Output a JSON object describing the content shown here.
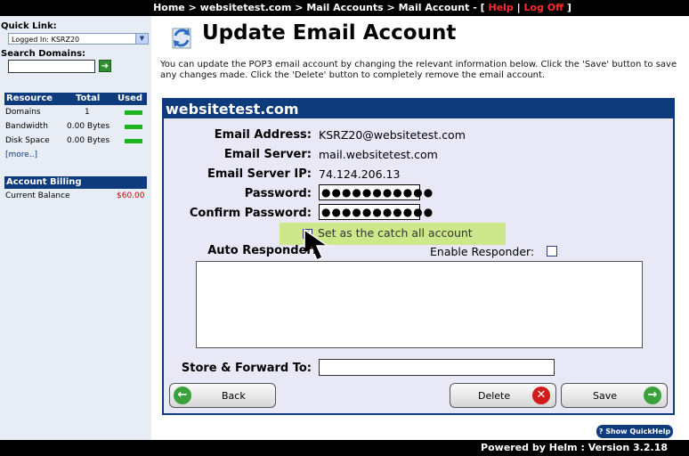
{
  "topnav": {
    "home": "Home",
    "sep": ">",
    "domain": "websitetest.com",
    "mail_accounts": "Mail Accounts",
    "mail_account": "Mail Account",
    "dash": "- [",
    "help": "Help",
    "pipe": "|",
    "logoff": "Log Off",
    "close": "]"
  },
  "sidebar": {
    "quick_link_label": "Quick Link:",
    "quick_link_value": "Logged In: KSRZ20",
    "search_label": "Search Domains:",
    "resource_table": {
      "headers": [
        "Resource",
        "Total",
        "Used"
      ],
      "rows": [
        {
          "name": "Domains",
          "total": "1",
          "used_fill": 1.0
        },
        {
          "name": "Bandwidth",
          "total": "0.00 Bytes",
          "used_fill": 1.0
        },
        {
          "name": "Disk Space",
          "total": "0.00 Bytes",
          "used_fill": 1.0
        }
      ],
      "more": "[more..]"
    },
    "billing": {
      "header": "Account Billing",
      "label": "Current Balance",
      "value": "$60.00"
    }
  },
  "main": {
    "title": "Update Email Account",
    "description": "You can update the POP3 email account by changing the relevant information below. Click the 'Save' button to save any changes made. Click the 'Delete' button to completely remove the email account.",
    "panel_title": "websitetest.com",
    "fields": {
      "email_address_label": "Email Address:",
      "email_address_value": "KSRZ20@websitetest.com",
      "email_server_label": "Email Server:",
      "email_server_value": "mail.websitetest.com",
      "email_server_ip_label": "Email Server IP:",
      "email_server_ip_value": "74.124.206.13",
      "password_label": "Password:",
      "password_value": "●●●●●●●●●●●",
      "confirm_password_label": "Confirm Password:",
      "confirm_password_value": "●●●●●●●●●●●",
      "catch_all_label": "Set as the catch all account",
      "auto_responder_label": "Auto Responder:",
      "enable_responder_label": "Enable Responder:",
      "store_forward_label": "Store & Forward To:"
    },
    "buttons": {
      "back": "Back",
      "delete": "Delete",
      "save": "Save"
    },
    "quickhelp": "Show QuickHelp"
  },
  "footer": {
    "text": "Powered by Helm  :  Version 3.2.18"
  },
  "colors": {
    "navy": "#0e3b7c",
    "green_bar": "#1db51d",
    "highlight": "#cde88b",
    "red": "#ff2a2a"
  }
}
